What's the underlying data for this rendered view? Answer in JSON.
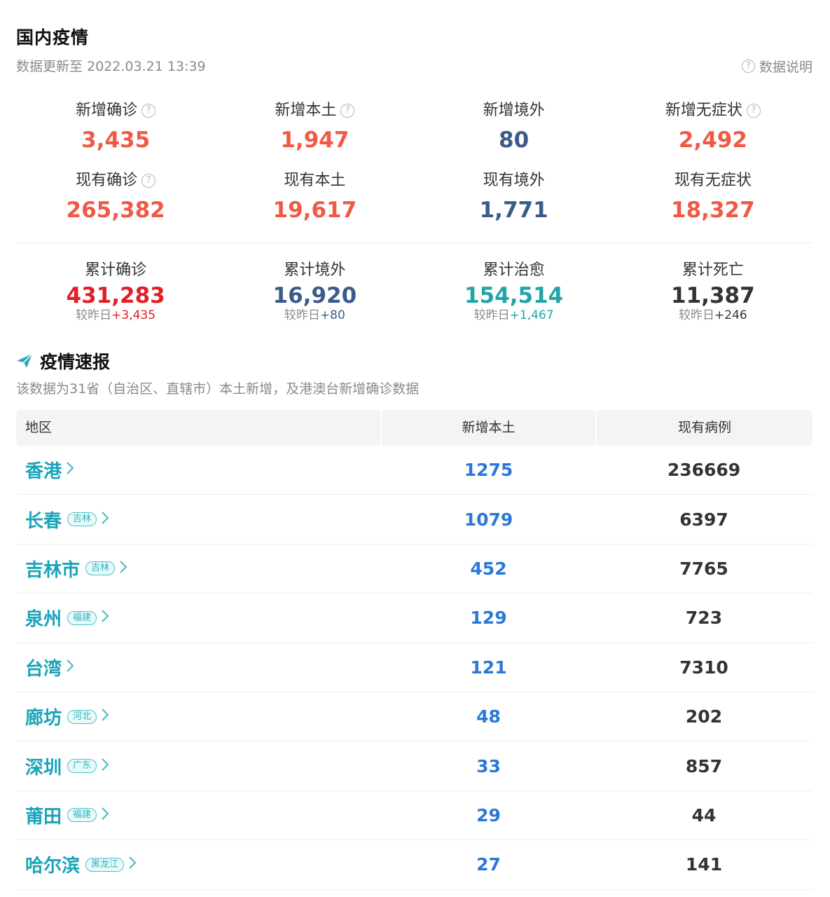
{
  "header": {
    "title": "国内疫情",
    "updated": "数据更新至 2022.03.21 13:39",
    "explain_label": "数据说明",
    "explain_icon": "question-circle-icon"
  },
  "colors": {
    "red_orange": "#f05a45",
    "navy": "#3c5b88",
    "red": "#e21e26",
    "teal": "#1aa3b8",
    "dark": "#333333",
    "blue": "#2b78d8"
  },
  "stats_row1": [
    {
      "label": "新增确诊",
      "value": "3,435",
      "help": true,
      "color": "#f05a45"
    },
    {
      "label": "新增本土",
      "value": "1,947",
      "help": true,
      "color": "#f05a45"
    },
    {
      "label": "新增境外",
      "value": "80",
      "help": false,
      "color": "#3c5b88"
    },
    {
      "label": "新增无症状",
      "value": "2,492",
      "help": true,
      "color": "#f05a45"
    }
  ],
  "stats_row2": [
    {
      "label": "现有确诊",
      "value": "265,382",
      "help": true,
      "color": "#f05a45"
    },
    {
      "label": "现有本土",
      "value": "19,617",
      "help": false,
      "color": "#f05a45"
    },
    {
      "label": "现有境外",
      "value": "1,771",
      "help": false,
      "color": "#3c5b88"
    },
    {
      "label": "现有无症状",
      "value": "18,327",
      "help": false,
      "color": "#f05a45"
    }
  ],
  "stats_row3": [
    {
      "label": "累计确诊",
      "value": "431,283",
      "diff_prefix": "较昨日",
      "diff_value": "+3,435",
      "color": "#e21e26"
    },
    {
      "label": "累计境外",
      "value": "16,920",
      "diff_prefix": "较昨日",
      "diff_value": "+80",
      "color": "#3c5b88"
    },
    {
      "label": "累计治愈",
      "value": "154,514",
      "diff_prefix": "较昨日",
      "diff_value": "+1,467",
      "color": "#22a5a8"
    },
    {
      "label": "累计死亡",
      "value": "11,387",
      "diff_prefix": "较昨日",
      "diff_value": "+246",
      "color": "#333333"
    }
  ],
  "section": {
    "title": "疫情速报",
    "icon": "paper-plane-icon",
    "description": "该数据为31省（自治区、直辖市）本土新增，及港澳台新增确诊数据"
  },
  "table": {
    "headers": [
      "地区",
      "新增本土",
      "现有病例"
    ],
    "rows": [
      {
        "city": "香港",
        "province": "",
        "new_local": "1275",
        "current": "236669"
      },
      {
        "city": "长春",
        "province": "吉林",
        "new_local": "1079",
        "current": "6397"
      },
      {
        "city": "吉林市",
        "province": "吉林",
        "new_local": "452",
        "current": "7765"
      },
      {
        "city": "泉州",
        "province": "福建",
        "new_local": "129",
        "current": "723"
      },
      {
        "city": "台湾",
        "province": "",
        "new_local": "121",
        "current": "7310"
      },
      {
        "city": "廊坊",
        "province": "河北",
        "new_local": "48",
        "current": "202"
      },
      {
        "city": "深圳",
        "province": "广东",
        "new_local": "33",
        "current": "857"
      },
      {
        "city": "莆田",
        "province": "福建",
        "new_local": "29",
        "current": "44"
      },
      {
        "city": "哈尔滨",
        "province": "黑龙江",
        "new_local": "27",
        "current": "141"
      }
    ]
  }
}
